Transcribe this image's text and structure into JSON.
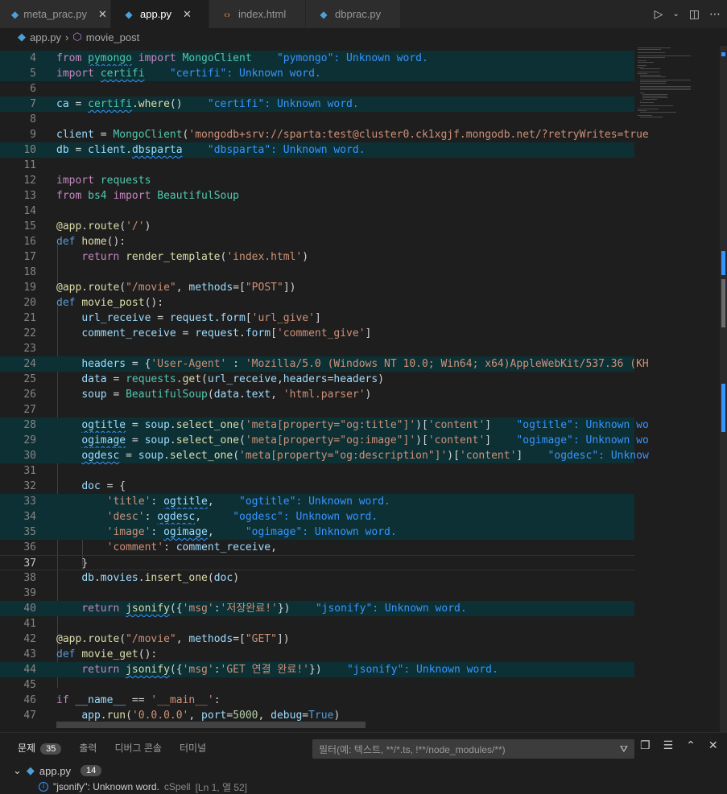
{
  "tabs": [
    {
      "label": "meta_prac.py",
      "icon": "python-icon",
      "close": "✕",
      "active": false
    },
    {
      "label": "app.py",
      "icon": "python-icon",
      "close": "✕",
      "active": true
    },
    {
      "label": "index.html",
      "icon": "html-icon",
      "close": "",
      "active": false
    },
    {
      "label": "dbprac.py",
      "icon": "python-icon",
      "close": "",
      "active": false
    }
  ],
  "breadcrumb": {
    "file": "app.py",
    "symbol": "movie_post"
  },
  "editor": {
    "lines": [
      {
        "n": "4",
        "hl": true,
        "html": "<span class=\"k\">from</span> <span class=\"c sq\">pymongo</span> <span class=\"k\">import</span> <span class=\"c\">MongoClient</span>    <span class=\"hint\">\"pymongo\": Unknown word.</span>"
      },
      {
        "n": "5",
        "hl": true,
        "html": "<span class=\"k\">import</span> <span class=\"c sq\">certifi</span>    <span class=\"hint\">\"certifi\": Unknown word.</span>"
      },
      {
        "n": "6",
        "html": ""
      },
      {
        "n": "7",
        "hl": true,
        "html": "<span class=\"v\">ca</span> = <span class=\"c sq\">certifi</span>.<span class=\"f\">where</span>()    <span class=\"hint\">\"certifi\": Unknown word.</span>"
      },
      {
        "n": "8",
        "html": ""
      },
      {
        "n": "9",
        "html": "<span class=\"v\">client</span> = <span class=\"c\">MongoClient</span>(<span class=\"s\">'mongodb+srv://sparta:test@cluster0.ck1xgjf.mongodb.net/?retryWrites=true</span>"
      },
      {
        "n": "10",
        "hl": true,
        "html": "<span class=\"v\">db</span> = <span class=\"v\">client</span>.<span class=\"v sq\">dbsparta</span>    <span class=\"hint\">\"dbsparta\": Unknown word.</span>"
      },
      {
        "n": "11",
        "html": ""
      },
      {
        "n": "12",
        "html": "<span class=\"k\">import</span> <span class=\"c\">requests</span>"
      },
      {
        "n": "13",
        "html": "<span class=\"k\">from</span> <span class=\"c\">bs4</span> <span class=\"k\">import</span> <span class=\"c\">BeautifulSoup</span>"
      },
      {
        "n": "14",
        "html": ""
      },
      {
        "n": "15",
        "html": "<span class=\"f\">@app.route</span>(<span class=\"s\">'/'</span>)"
      },
      {
        "n": "16",
        "html": "<span class=\"d\">def</span> <span class=\"f\">home</span>():"
      },
      {
        "n": "17",
        "html": "    <span class=\"k\">return</span> <span class=\"f\">render_template</span>(<span class=\"s\">'index.html'</span>)"
      },
      {
        "n": "18",
        "html": ""
      },
      {
        "n": "19",
        "html": "<span class=\"f\">@app.route</span>(<span class=\"s\">\"/movie\"</span>, <span class=\"v\">methods</span>=[<span class=\"s\">\"POST\"</span>])"
      },
      {
        "n": "20",
        "html": "<span class=\"d\">def</span> <span class=\"f\">movie_post</span>():"
      },
      {
        "n": "21",
        "html": "    <span class=\"v\">url_receive</span> = <span class=\"v\">request</span>.<span class=\"v\">form</span>[<span class=\"s\">'url_give'</span>]"
      },
      {
        "n": "22",
        "html": "    <span class=\"v\">comment_receive</span> = <span class=\"v\">request</span>.<span class=\"v\">form</span>[<span class=\"s\">'comment_give'</span>]"
      },
      {
        "n": "23",
        "html": ""
      },
      {
        "n": "24",
        "hl": true,
        "html": "    <span class=\"v\">headers</span> = {<span class=\"s\">'User-Agent'</span> : <span class=\"s\">'Mozilla/5.0 (Windows NT 10.0; Win64; x64)AppleWebKit/537.36 (KH</span>"
      },
      {
        "n": "25",
        "html": "    <span class=\"v\">data</span> = <span class=\"c\">requests</span>.<span class=\"f\">get</span>(<span class=\"v\">url_receive</span>,<span class=\"v\">headers</span>=<span class=\"v\">headers</span>)"
      },
      {
        "n": "26",
        "html": "    <span class=\"v\">soup</span> = <span class=\"c\">BeautifulSoup</span>(<span class=\"v\">data</span>.<span class=\"v\">text</span>, <span class=\"s\">'html.parser'</span>)"
      },
      {
        "n": "27",
        "html": ""
      },
      {
        "n": "28",
        "hl": true,
        "html": "    <span class=\"v sq\">ogtitle</span> = <span class=\"v\">soup</span>.<span class=\"f\">select_one</span>(<span class=\"s\">'meta[property=\"og:title\"]'</span>)[<span class=\"s\">'content'</span>]    <span class=\"hint\">\"ogtitle\": Unknown wo</span>"
      },
      {
        "n": "29",
        "hl": true,
        "html": "    <span class=\"v sq\">ogimage</span> = <span class=\"v\">soup</span>.<span class=\"f\">select_one</span>(<span class=\"s\">'meta[property=\"og:image\"]'</span>)[<span class=\"s\">'content'</span>]    <span class=\"hint\">\"ogimage\": Unknown wo</span>"
      },
      {
        "n": "30",
        "hl": true,
        "html": "    <span class=\"v sq\">ogdesc</span> = <span class=\"v\">soup</span>.<span class=\"f\">select_one</span>(<span class=\"s\">'meta[property=\"og:description\"]'</span>)[<span class=\"s\">'content'</span>]    <span class=\"hint\">\"ogdesc\": Unknow</span>"
      },
      {
        "n": "31",
        "html": ""
      },
      {
        "n": "32",
        "html": "    <span class=\"v\">doc</span> = {"
      },
      {
        "n": "33",
        "hl": true,
        "html": "        <span class=\"s\">'title'</span>: <span class=\"v sq\">ogtitle</span>,    <span class=\"hint\">\"ogtitle\": Unknown word.</span>"
      },
      {
        "n": "34",
        "hl": true,
        "html": "        <span class=\"s\">'desc'</span>: <span class=\"v sq\">ogdesc</span>,     <span class=\"hint\">\"ogdesc\": Unknown word.</span>"
      },
      {
        "n": "35",
        "hl": true,
        "html": "        <span class=\"s\">'image'</span>: <span class=\"v sq\">ogimage</span>,     <span class=\"hint\">\"ogimage\": Unknown word.</span>"
      },
      {
        "n": "36",
        "html": "        <span class=\"s\">'comment'</span>: <span class=\"v\">comment_receive</span>,"
      },
      {
        "n": "37",
        "cur": true,
        "html": "    }"
      },
      {
        "n": "38",
        "html": "    <span class=\"v\">db</span>.<span class=\"v\">movies</span>.<span class=\"f\">insert_one</span>(<span class=\"v\">doc</span>)"
      },
      {
        "n": "39",
        "html": ""
      },
      {
        "n": "40",
        "hl": true,
        "html": "    <span class=\"k\">return</span> <span class=\"f sq\">jsonify</span>({<span class=\"s\">'msg'</span>:<span class=\"s\">'저장완료!'</span>})    <span class=\"hint\">\"jsonify\": Unknown word.</span>"
      },
      {
        "n": "41",
        "html": ""
      },
      {
        "n": "42",
        "html": "<span class=\"f\">@app.route</span>(<span class=\"s\">\"/movie\"</span>, <span class=\"v\">methods</span>=[<span class=\"s\">\"GET\"</span>])"
      },
      {
        "n": "43",
        "html": "<span class=\"d\">def</span> <span class=\"f\">movie_get</span>():"
      },
      {
        "n": "44",
        "hl": true,
        "html": "    <span class=\"k\">return</span> <span class=\"f sq\">jsonify</span>({<span class=\"s\">'msg'</span>:<span class=\"s\">'GET 연결 완료!'</span>})    <span class=\"hint\">\"jsonify\": Unknown word.</span>"
      },
      {
        "n": "45",
        "html": ""
      },
      {
        "n": "46",
        "html": "<span class=\"k\">if</span> <span class=\"v\">__name__</span> == <span class=\"s\">'__main__'</span>:"
      },
      {
        "n": "47",
        "html": "    <span class=\"v\">app</span>.<span class=\"f\">run</span>(<span class=\"s\">'0.0.0.0'</span>, <span class=\"v\">port</span>=<span class=\"n\">5000</span>, <span class=\"v\">debug</span>=<span class=\"d\">True</span>)"
      }
    ]
  },
  "panel": {
    "tabs": [
      {
        "label": "문제",
        "badge": "35",
        "active": true
      },
      {
        "label": "출력",
        "badge": "",
        "active": false
      },
      {
        "label": "디버그 콘솔",
        "badge": "",
        "active": false
      },
      {
        "label": "터미널",
        "badge": "",
        "active": false
      }
    ],
    "filter_placeholder": "필터(예: 텍스트, **/*.ts, !**/node_modules/**)",
    "group": {
      "file": "app.py",
      "count": "14"
    },
    "problem": {
      "message": "\"jsonify\": Unknown word.",
      "source": "cSpell",
      "location": "[Ln 1, 열 52]"
    }
  }
}
